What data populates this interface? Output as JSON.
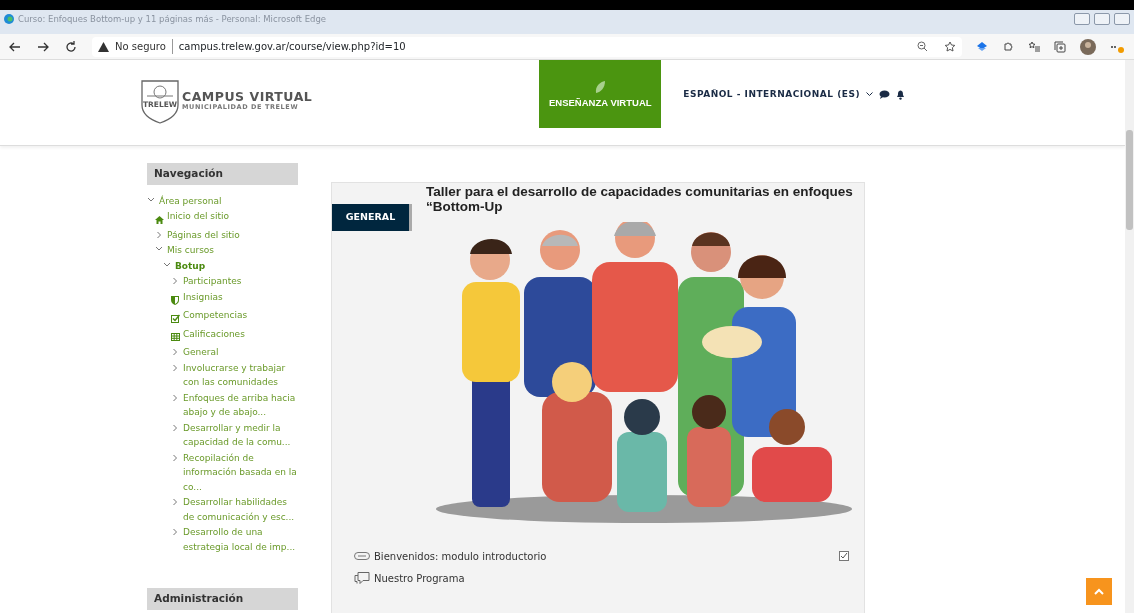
{
  "browser": {
    "title": "Curso: Enfoques Bottom-up y 11 páginas más - Personal: Microsoft Edge",
    "security": "No seguro",
    "url": "campus.trelew.gov.ar/course/view.php?id=10"
  },
  "header": {
    "logo_title": "CAMPUS VIRTUAL",
    "logo_subtitle": "MUNICIPALIDAD DE TRELEW",
    "logo_badge": "TRELEW",
    "teaching_button": "ENSEÑANZA VIRTUAL",
    "language": "ESPAÑOL - INTERNACIONAL (ES)"
  },
  "sidebar": {
    "blocks": [
      {
        "title": "Navegación",
        "tree": [
          {
            "label": "Área personal",
            "kind": "branch",
            "expanded": true,
            "selected": false,
            "children": [
              {
                "label": "Inicio del sitio",
                "kind": "home",
                "selected": false
              },
              {
                "label": "Páginas del sitio",
                "kind": "branch",
                "expanded": false,
                "selected": false
              },
              {
                "label": "Mis cursos",
                "kind": "branch",
                "expanded": true,
                "selected": false,
                "children": [
                  {
                    "label": "Botup",
                    "kind": "branch",
                    "expanded": true,
                    "selected": true,
                    "children": [
                      {
                        "label": "Participantes",
                        "kind": "branch",
                        "expanded": false,
                        "selected": false
                      },
                      {
                        "label": "Insignias",
                        "kind": "shield",
                        "selected": false
                      },
                      {
                        "label": "Competencias",
                        "kind": "check",
                        "selected": false
                      },
                      {
                        "label": "Calificaciones",
                        "kind": "grid",
                        "selected": false
                      },
                      {
                        "label": "General",
                        "kind": "branch",
                        "expanded": false,
                        "selected": false
                      },
                      {
                        "label": "Involucrarse y trabajar con las comunidades",
                        "kind": "branch",
                        "expanded": false,
                        "selected": false
                      },
                      {
                        "label": "Enfoques de arriba hacia abajo y de abajo...",
                        "kind": "branch",
                        "expanded": false,
                        "selected": false
                      },
                      {
                        "label": "Desarrollar y medir la capacidad de la comu...",
                        "kind": "branch",
                        "expanded": false,
                        "selected": false
                      },
                      {
                        "label": "Recopilación de información basada en la co...",
                        "kind": "branch",
                        "expanded": false,
                        "selected": false
                      },
                      {
                        "label": "Desarrollar habilidades de comunicación y esc...",
                        "kind": "branch",
                        "expanded": false,
                        "selected": false
                      },
                      {
                        "label": "Desarrollo de una estrategia local de imp...",
                        "kind": "branch",
                        "expanded": false,
                        "selected": false
                      }
                    ]
                  }
                ]
              }
            ]
          }
        ]
      },
      {
        "title": "Administración"
      }
    ]
  },
  "course": {
    "section_tab": "GENERAL",
    "title": "Taller para el desarrollo de capacidades comunitarias en enfoques “Bottom-Up",
    "activities": [
      {
        "kind": "url",
        "name": "Bienvenidos: modulo introductorio",
        "completed": true
      },
      {
        "kind": "forum",
        "name": "Nuestro Programa"
      }
    ]
  }
}
